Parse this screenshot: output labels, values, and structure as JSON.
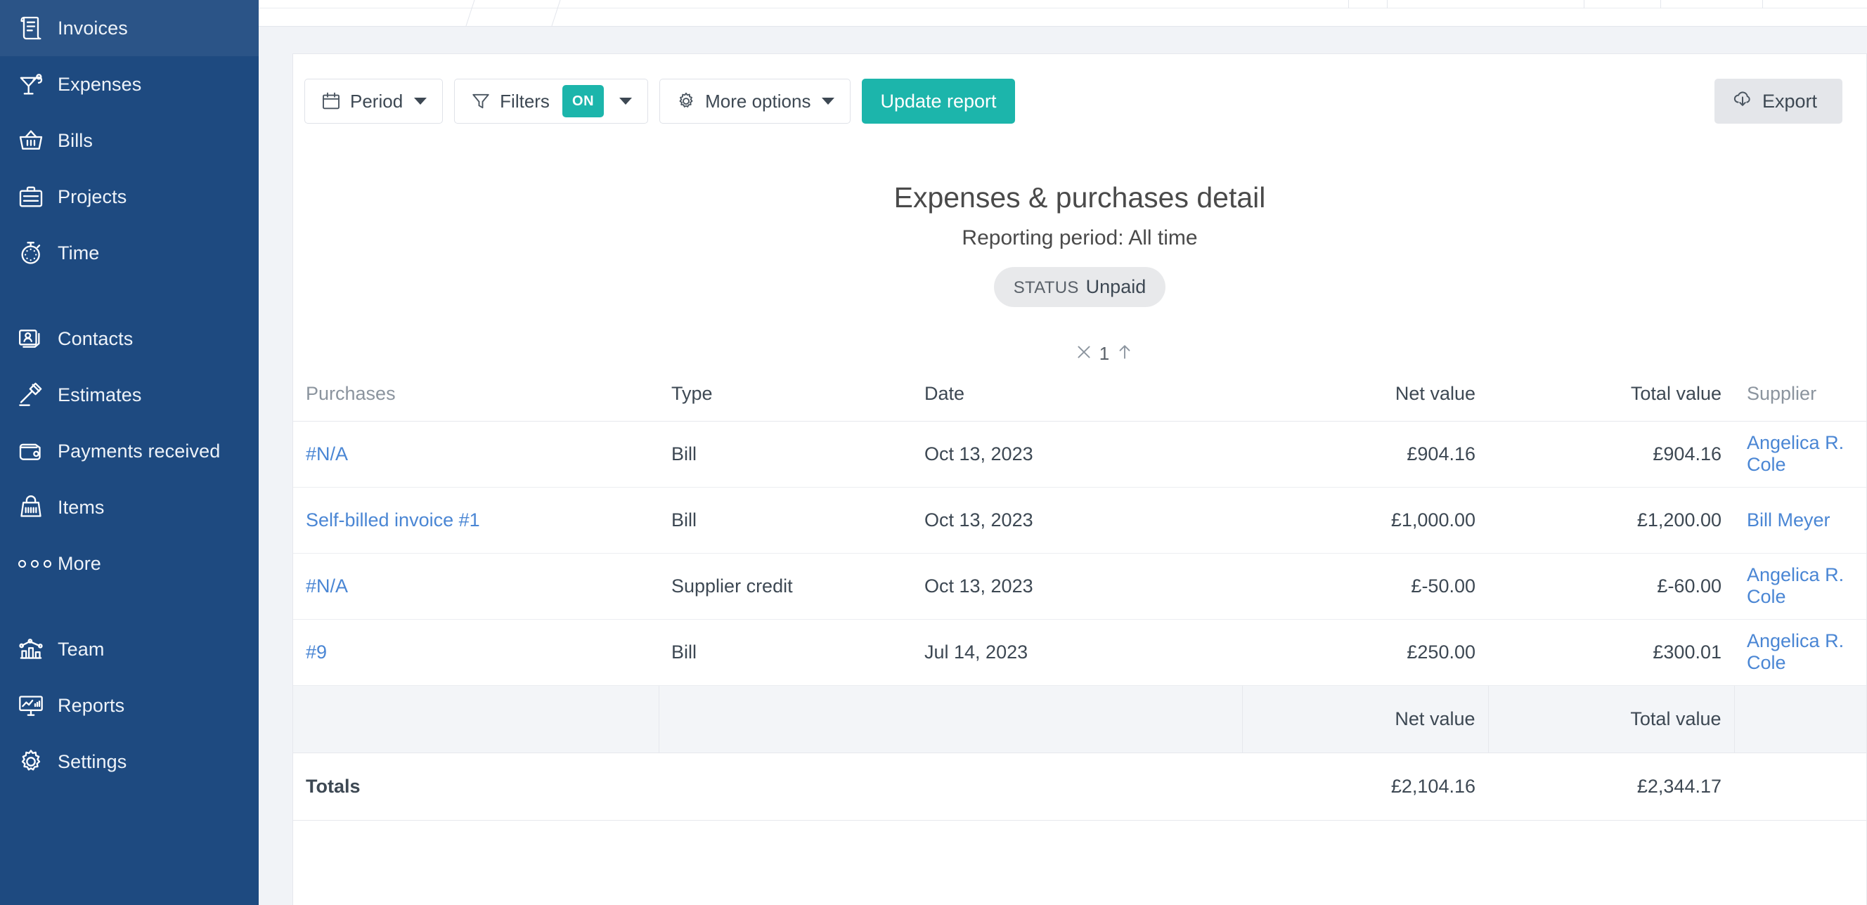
{
  "sidebar": {
    "items": [
      {
        "label": "Invoices",
        "icon": "invoice-icon"
      },
      {
        "label": "Expenses",
        "icon": "cocktail-icon"
      },
      {
        "label": "Bills",
        "icon": "basket-icon"
      },
      {
        "label": "Projects",
        "icon": "briefcase-icon"
      },
      {
        "label": "Time",
        "icon": "stopwatch-icon"
      }
    ],
    "items2": [
      {
        "label": "Contacts",
        "icon": "contacts-icon"
      },
      {
        "label": "Estimates",
        "icon": "gavel-icon"
      },
      {
        "label": "Payments received",
        "icon": "wallet-icon"
      },
      {
        "label": "Items",
        "icon": "shopping-bag-icon"
      },
      {
        "label": "More",
        "icon": "ellipsis-icon"
      }
    ],
    "items3": [
      {
        "label": "Team",
        "icon": "team-chart-icon"
      },
      {
        "label": "Reports",
        "icon": "monitor-chart-icon"
      },
      {
        "label": "Settings",
        "icon": "gear-icon"
      }
    ]
  },
  "toolbar": {
    "period_label": "Period",
    "filters_label": "Filters",
    "filters_state": "ON",
    "more_options_label": "More options",
    "update_report_label": "Update report",
    "export_label": "Export"
  },
  "report": {
    "title": "Expenses & purchases detail",
    "subtitle": "Reporting period: All time",
    "status_label": "STATUS",
    "status_value": "Unpaid",
    "sort_count": "1"
  },
  "table": {
    "headers": {
      "purchases": "Purchases",
      "type": "Type",
      "date": "Date",
      "net_value": "Net value",
      "total_value": "Total value",
      "supplier": "Supplier"
    },
    "rows": [
      {
        "purchases": "#N/A",
        "type": "Bill",
        "date": "Oct 13, 2023",
        "net_value": "£904.16",
        "total_value": "£904.16",
        "supplier": "Angelica R. Cole"
      },
      {
        "purchases": "Self-billed invoice #1",
        "type": "Bill",
        "date": "Oct 13, 2023",
        "net_value": "£1,000.00",
        "total_value": "£1,200.00",
        "supplier": "Bill Meyer"
      },
      {
        "purchases": "#N/A",
        "type": "Supplier credit",
        "date": "Oct 13, 2023",
        "net_value": "£-50.00",
        "total_value": "£-60.00",
        "supplier": "Angelica R. Cole"
      },
      {
        "purchases": "#9",
        "type": "Bill",
        "date": "Jul 14, 2023",
        "net_value": "£250.00",
        "total_value": "£300.01",
        "supplier": "Angelica R. Cole"
      }
    ],
    "summary_headers": {
      "net_value": "Net value",
      "total_value": "Total value"
    },
    "totals": {
      "label": "Totals",
      "net_value": "£2,104.16",
      "total_value": "£2,344.17"
    }
  },
  "colors": {
    "sidebar_bg": "#1e4a80",
    "accent_teal": "#1cb5ab",
    "link_blue": "#4a86d4",
    "page_bg": "#f1f3f7"
  }
}
